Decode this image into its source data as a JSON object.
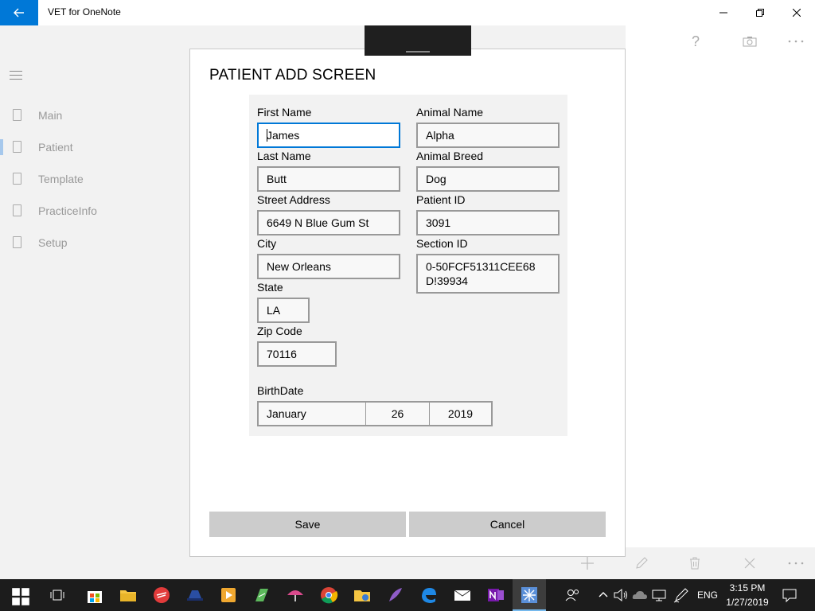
{
  "app": {
    "title": "VET for OneNote"
  },
  "sidebar": {
    "items": [
      {
        "label": "Main"
      },
      {
        "label": "Patient"
      },
      {
        "label": "Template"
      },
      {
        "label": "PracticeInfo"
      },
      {
        "label": "Setup"
      }
    ],
    "selected_index": 1
  },
  "dialog": {
    "title": "PATIENT ADD SCREEN",
    "fields": {
      "first_name": {
        "label": "First Name",
        "value": "James"
      },
      "last_name": {
        "label": "Last Name",
        "value": "Butt"
      },
      "street_address": {
        "label": "Street Address",
        "value": "6649 N Blue Gum St"
      },
      "city": {
        "label": "City",
        "value": "New Orleans"
      },
      "state": {
        "label": "State",
        "value": "LA"
      },
      "zip_code": {
        "label": "Zip Code",
        "value": "70116"
      },
      "animal_name": {
        "label": "Animal Name",
        "value": "Alpha"
      },
      "animal_breed": {
        "label": "Animal Breed",
        "value": "Dog"
      },
      "patient_id": {
        "label": "Patient ID",
        "value": "3091"
      },
      "section_id": {
        "label": "Section ID",
        "value": "0-50FCF51311CEE68D!39934"
      }
    },
    "birthdate": {
      "label": "BirthDate",
      "month": "January",
      "day": "26",
      "year": "2019"
    },
    "save_label": "Save",
    "cancel_label": "Cancel"
  },
  "taskbar": {
    "language": "ENG",
    "time": "3:15 PM",
    "date": "1/27/2019"
  },
  "colors": {
    "accent": "#0078d7",
    "taskbar": "#1c1c1c",
    "button": "#cccccc"
  }
}
